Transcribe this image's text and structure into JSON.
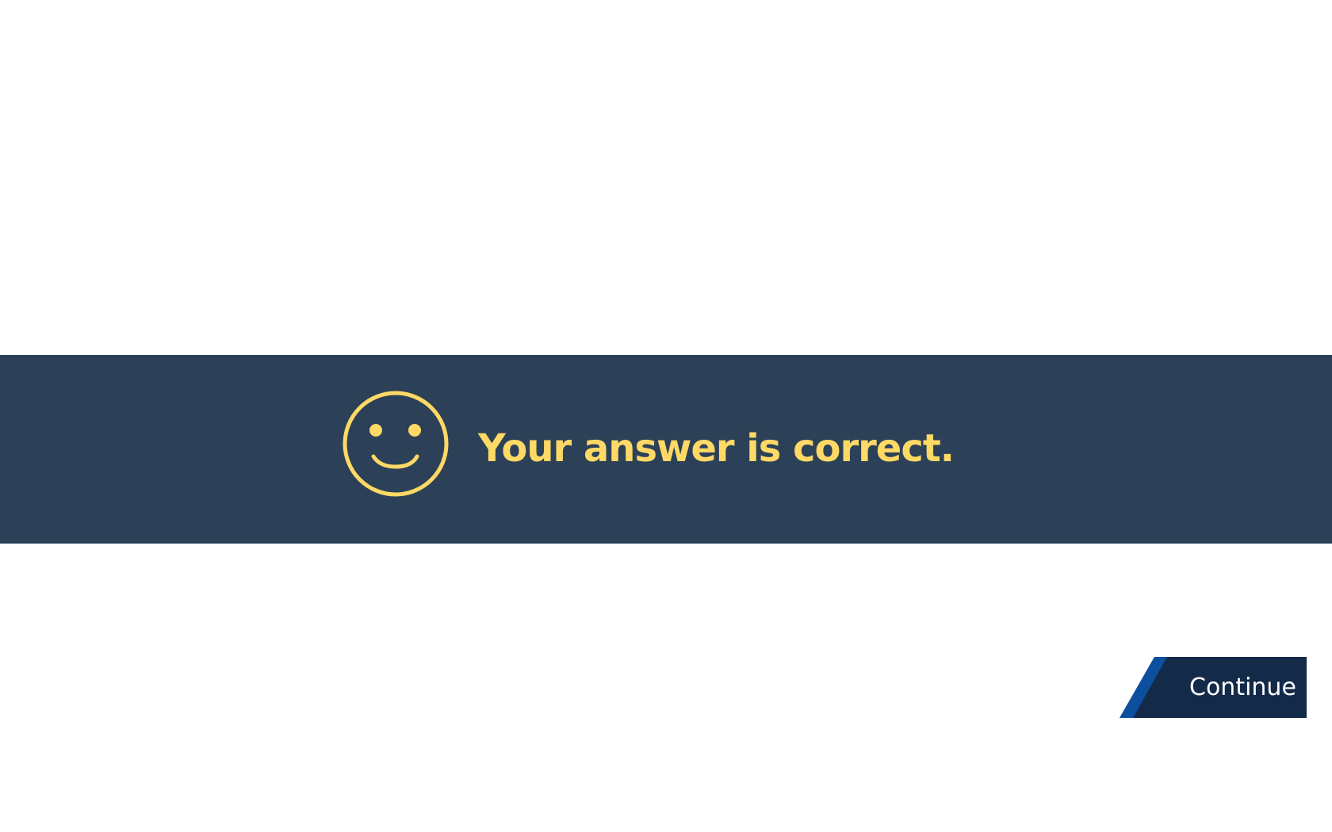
{
  "feedback": {
    "message": "Your answer is correct.",
    "icon": "smiley-face-icon",
    "text_color": "#ffd966",
    "band_color": "#2c4157"
  },
  "navigation": {
    "continue_label": "Continue",
    "button_color": "#132a48",
    "accent_color": "#0b4f9e"
  }
}
